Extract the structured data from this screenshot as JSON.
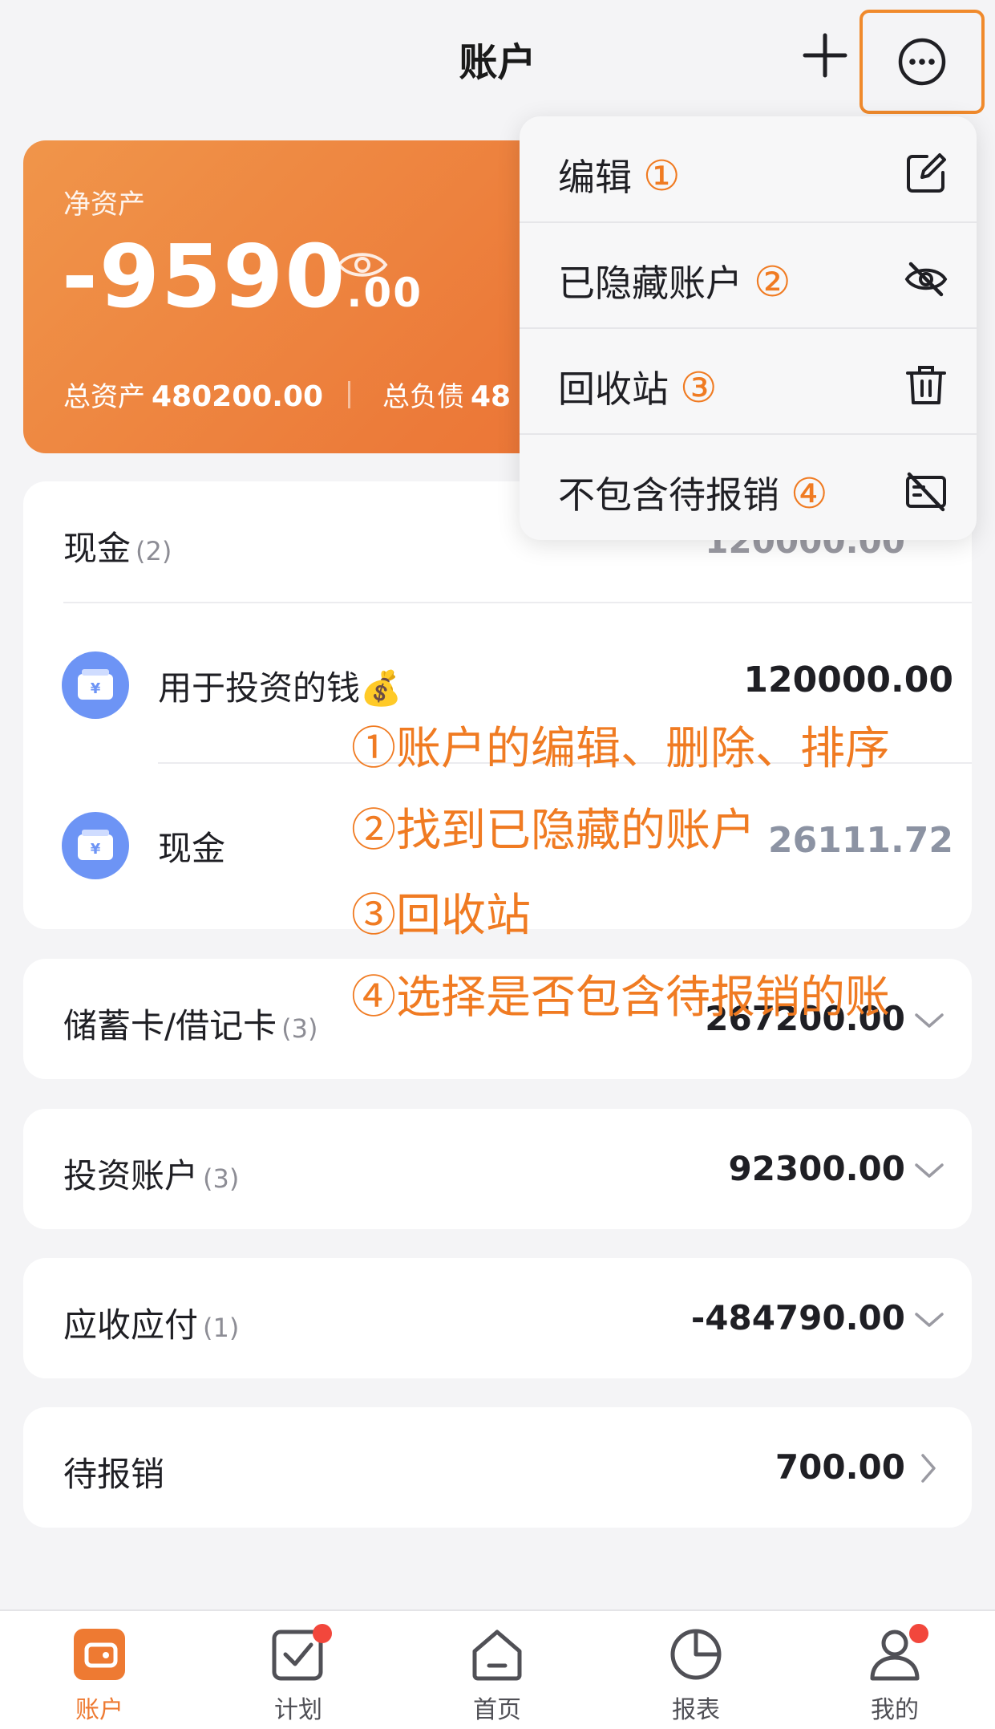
{
  "header": {
    "title": "账户"
  },
  "networth": {
    "label": "净资产",
    "value_int": "-9590",
    "value_dec": ".00",
    "assets_label": "总资产",
    "assets_value": "480200.00",
    "debt_label": "总负债",
    "debt_value": "48"
  },
  "groups": {
    "cash": {
      "name": "现金",
      "count": "(2)",
      "amount": "120000.00",
      "accounts": [
        {
          "name": "用于投资的钱💰",
          "amount": "120000.00"
        },
        {
          "name": "现金",
          "amount": "26111.72"
        }
      ]
    },
    "debit": {
      "name": "储蓄卡/借记卡",
      "count": "(3)",
      "amount": "267200.00"
    },
    "invest": {
      "name": "投资账户",
      "count": "(3)",
      "amount": "92300.00"
    },
    "receivable": {
      "name": "应收应付",
      "count": "(1)",
      "amount": "-484790.00"
    },
    "reimburse": {
      "name": "待报销",
      "count": "",
      "amount": "700.00"
    }
  },
  "menu": {
    "items": [
      {
        "label": "编辑",
        "num": "①",
        "icon": "edit-icon"
      },
      {
        "label": "已隐藏账户",
        "num": "②",
        "icon": "eye-off-icon"
      },
      {
        "label": "回收站",
        "num": "③",
        "icon": "trash-icon"
      },
      {
        "label": "不包含待报销",
        "num": "④",
        "icon": "no-reimburse-icon"
      }
    ]
  },
  "annotations": [
    "①账户的编辑、删除、排序",
    "②找到已隐藏的账户",
    "③回收站",
    "④选择是否包含待报销的账"
  ],
  "tabs": [
    {
      "label": "账户",
      "active": true
    },
    {
      "label": "计划",
      "badge": true
    },
    {
      "label": "首页"
    },
    {
      "label": "报表"
    },
    {
      "label": "我的",
      "badge": true
    }
  ],
  "colors": {
    "accent": "#f08a2c",
    "annotation": "#f07b22",
    "account_icon": "#6d94f5",
    "badge": "#f2473c"
  }
}
